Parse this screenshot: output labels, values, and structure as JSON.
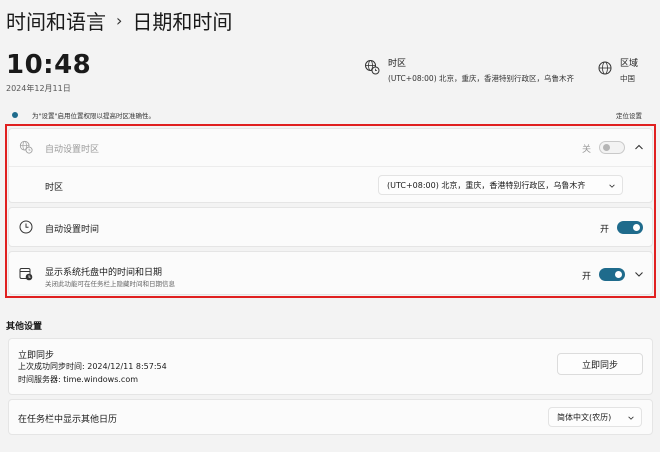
{
  "breadcrumb": {
    "parent": "时间和语言",
    "separator": "›",
    "current": "日期和时间"
  },
  "clock": {
    "time": "10:48",
    "date": "2024年12月11日"
  },
  "timezone_info": {
    "title": "时区",
    "value": "(UTC+08:00) 北京，重庆，香港特别行政区，乌鲁木齐"
  },
  "region_info": {
    "title": "区域",
    "value": "中国"
  },
  "notice": {
    "text": "为\"设置\"启用位置权限以提高时区准确性。",
    "link": "定位设置"
  },
  "auto_timezone": {
    "label": "自动设置时区",
    "state_label": "关",
    "on": false
  },
  "timezone_row": {
    "label": "时区",
    "selected": "(UTC+08:00) 北京，重庆，香港特别行政区，乌鲁木齐"
  },
  "auto_time": {
    "label": "自动设置时间",
    "state_label": "开",
    "on": true
  },
  "tray": {
    "label": "显示系统托盘中的时间和日期",
    "desc": "关闭此功能可在任务栏上隐藏时间和日期信息",
    "state_label": "开",
    "on": true
  },
  "other": {
    "title": "其他设置",
    "sync": {
      "label": "立即同步",
      "last_sync": "上次成功同步时间: 2024/12/11 8:57:54",
      "server": "时间服务器: time.windows.com",
      "button": "立即同步"
    },
    "calendar": {
      "label": "在任务栏中显示其他日历",
      "selected": "简体中文(农历)"
    }
  },
  "colors": {
    "accent": "#1f6b8c",
    "highlight_border": "#e02020",
    "background": "#f3f3f3"
  }
}
